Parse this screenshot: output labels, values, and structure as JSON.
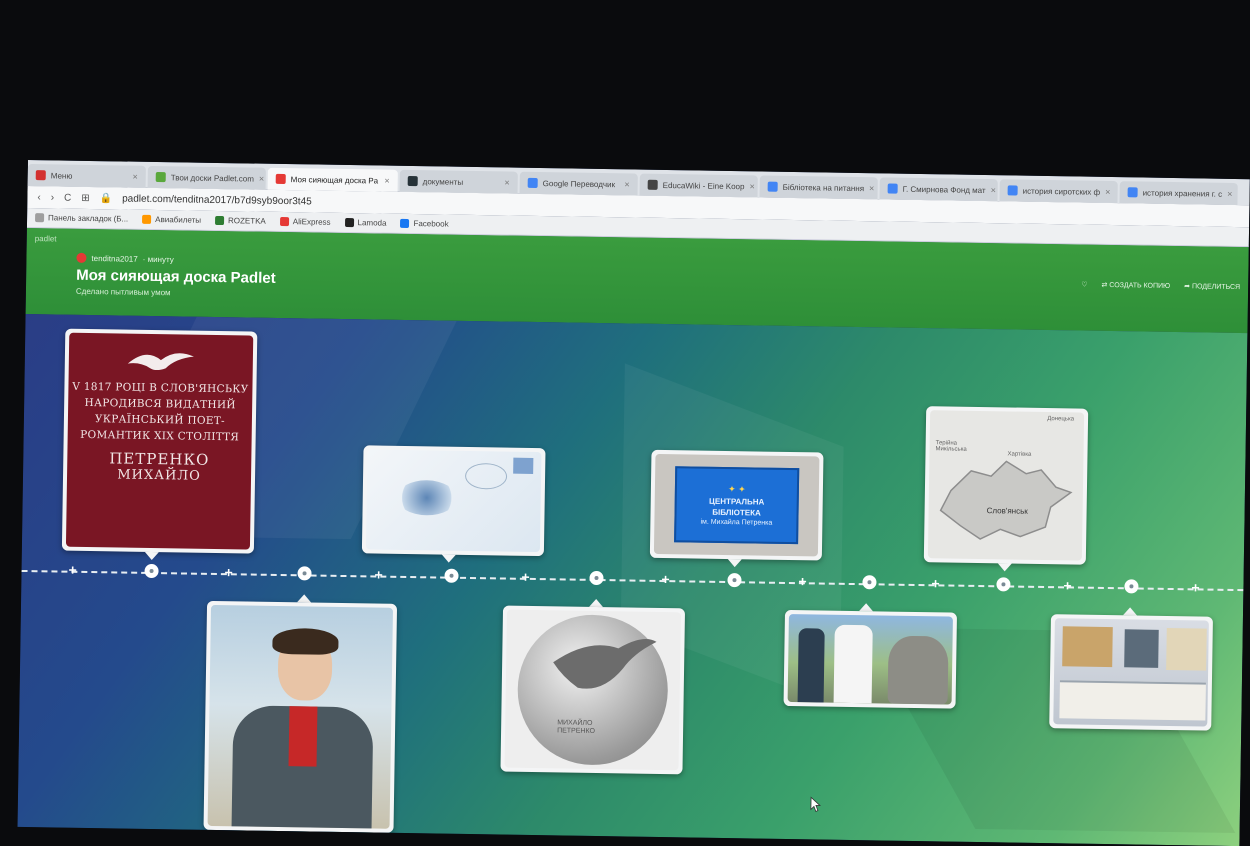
{
  "browser": {
    "tabs": [
      {
        "label": "Меню",
        "color": "#d3302f",
        "active": false
      },
      {
        "label": "Твои доски Padlet.com",
        "color": "#5aa83c",
        "active": false
      },
      {
        "label": "Моя сияющая доска Pa",
        "color": "#e53935",
        "active": true
      },
      {
        "label": "документы",
        "color": "#263238",
        "active": false
      },
      {
        "label": "Google Переводчик",
        "color": "#4285f4",
        "active": false
      },
      {
        "label": "EducaWiki - Eine Koop",
        "color": "#444444",
        "active": false
      },
      {
        "label": "Бібліотека на питання",
        "color": "#4285f4",
        "active": false
      },
      {
        "label": "Г. Смирнова Фонд мат",
        "color": "#4285f4",
        "active": false
      },
      {
        "label": "история сиротских ф",
        "color": "#4285f4",
        "active": false
      },
      {
        "label": "история хранения г. с",
        "color": "#4285f4",
        "active": false
      }
    ],
    "url": "padlet.com/tenditna2017/b7d9syb9oor3t45",
    "bookmarks": [
      {
        "label": "Панель закладок (Б...",
        "color": "#9e9e9e"
      },
      {
        "label": "Авиабилеты",
        "color": "#ff9800"
      },
      {
        "label": "ROZETKA",
        "color": "#2e7d32"
      },
      {
        "label": "AliExpress",
        "color": "#e53935"
      },
      {
        "label": "Lamoda",
        "color": "#222222"
      },
      {
        "label": "Facebook",
        "color": "#1877f2"
      }
    ]
  },
  "padlet": {
    "brand": "padlet",
    "author": "tenditna2017",
    "time": "· минуту",
    "title": "Моя сияющая доска Padlet",
    "subtitle": "Сделано пытливым умом",
    "actions": [
      "♡",
      "⇄ СОЗДАТЬ КОПИЮ",
      "➦ ПОДЕЛИТЬСЯ"
    ]
  },
  "posts": {
    "plaque": {
      "lines": [
        "V 1817 РОЦІ В СЛОВ'ЯНСЬКУ",
        "НАРОДИВСЯ ВИДАТНИЙ",
        "УКРАЇНСЬКИЙ ПОЕТ-",
        "РОМАНТИК XIX СТОЛІТТЯ"
      ],
      "name_last": "ПЕТРЕНКО",
      "name_first": "МИХАЙЛО"
    },
    "library": {
      "line1": "ЦЕНТРАЛЬНА",
      "line2": "БІБЛІОТЕКА",
      "line3": "ім. Михайла Петренка"
    },
    "map": {
      "label_city": "Слов'янськ",
      "label_north": "Донецька",
      "label_west": "Терійна Микільська",
      "label_mid": "Хартівка"
    },
    "coin": {
      "text_line1": "МИХАЙЛО",
      "text_line2": "ПЕТРЕНКО"
    }
  }
}
